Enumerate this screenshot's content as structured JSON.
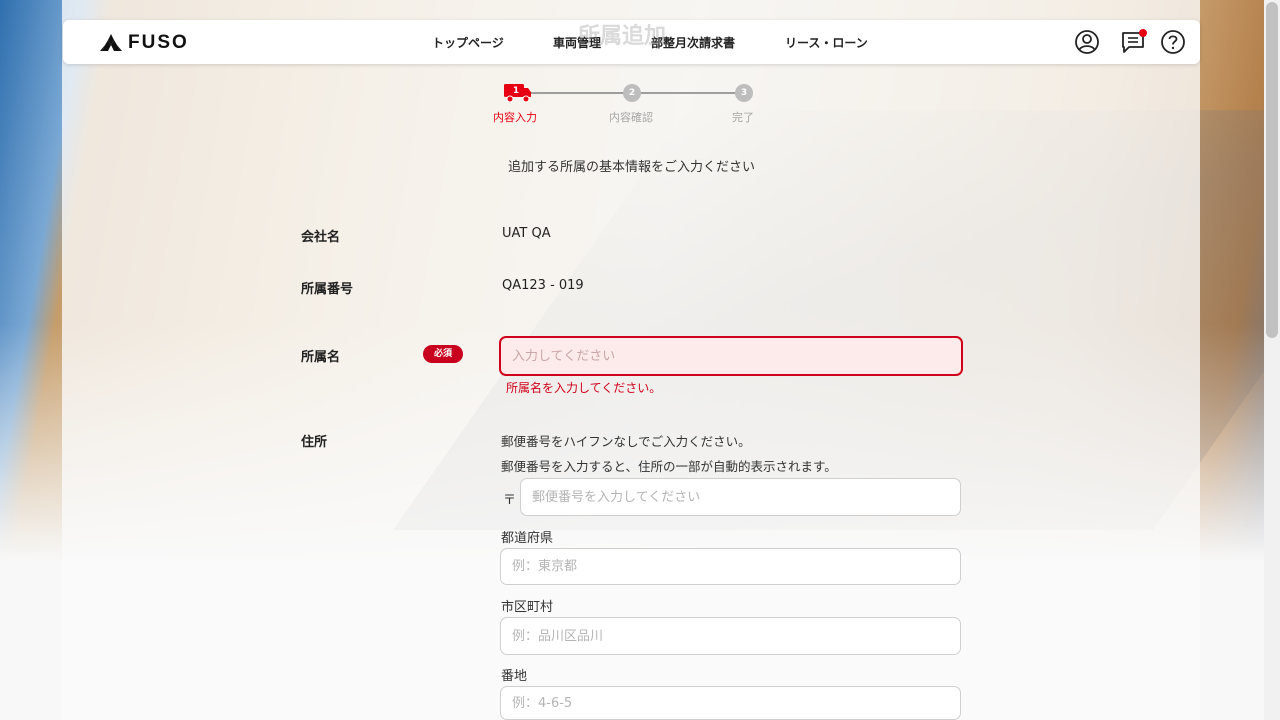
{
  "page": {
    "title_ghost": "所属追加"
  },
  "header": {
    "logo_text": "FUSO",
    "nav": [
      {
        "label": "トップページ"
      },
      {
        "label": "車両管理"
      },
      {
        "label": "部整月次請求書"
      },
      {
        "label": "リース・ローン"
      }
    ],
    "icons": [
      "account-icon",
      "message-icon",
      "help-icon"
    ],
    "has_notification": true
  },
  "stepper": {
    "steps": [
      {
        "number": "1",
        "label": "内容入力",
        "active": true
      },
      {
        "number": "2",
        "label": "内容確認",
        "active": false
      },
      {
        "number": "3",
        "label": "完了",
        "active": false
      }
    ]
  },
  "form": {
    "intro": "追加する所属の基本情報をご入力ください",
    "company": {
      "label": "会社名",
      "value": "UAT QA"
    },
    "affiliation_number": {
      "label": "所属番号",
      "value": "QA123 - 019"
    },
    "affiliation_name": {
      "label": "所属名",
      "required_badge": "必須",
      "placeholder": "入力してください",
      "value": "",
      "error": "所属名を入力してください。"
    },
    "address": {
      "label": "住所",
      "note1": "郵便番号をハイフンなしでご入力ください。",
      "note2": "郵便番号を入力すると、住所の一部が自動的表示されます。",
      "postal_mark": "〒",
      "postal_placeholder": "郵便番号を入力してください",
      "prefecture_label": "都道府県",
      "prefecture_placeholder": "例：東京都",
      "city_label": "市区町村",
      "city_placeholder": "例：品川区品川",
      "street_label": "番地",
      "street_placeholder": "例：4-6-5"
    }
  },
  "colors": {
    "accent": "#e60012",
    "error": "#d0021b",
    "error_bg": "#fdeaea",
    "badge": "#c8001d"
  }
}
